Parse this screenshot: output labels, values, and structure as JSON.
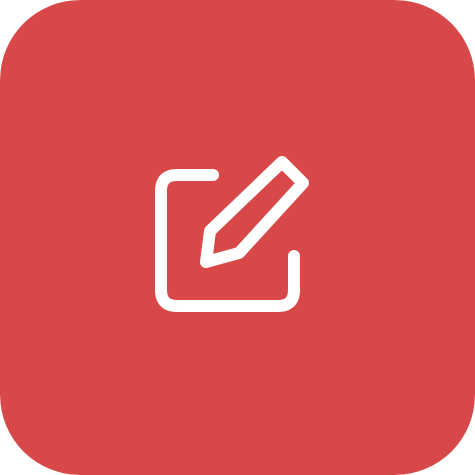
{
  "app_icon": {
    "icon": "edit-icon",
    "colors": {
      "background": "#D94848",
      "glyph": "#FFFFFF"
    }
  }
}
